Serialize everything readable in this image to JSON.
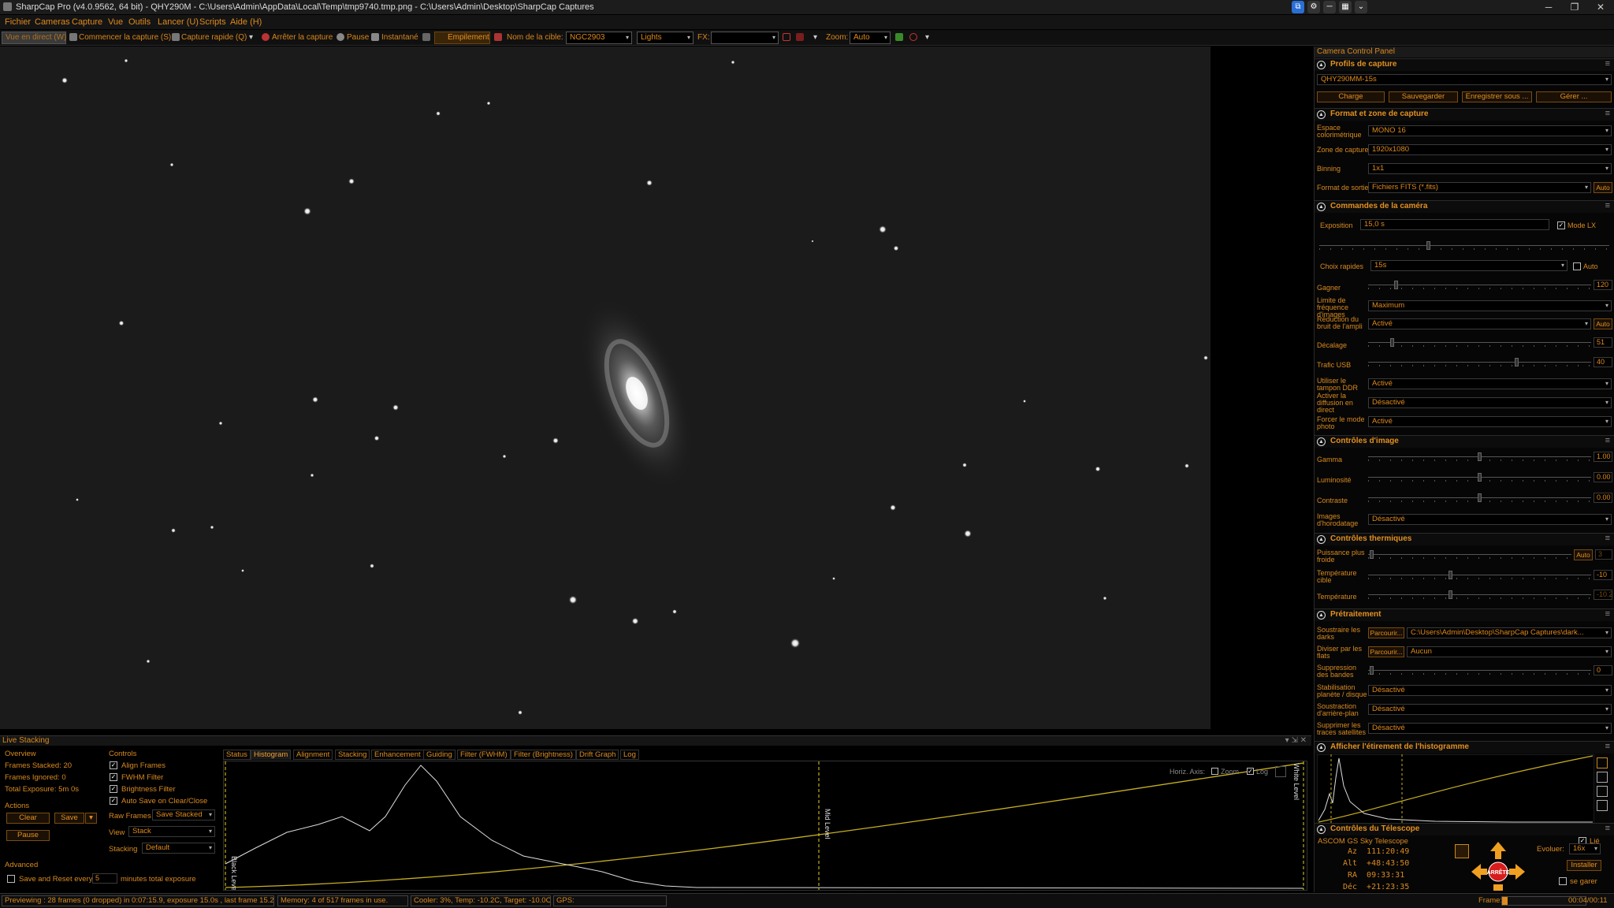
{
  "window": {
    "title": "SharpCap Pro (v4.0.9562, 64 bit) - QHY290M - C:\\Users\\Admin\\AppData\\Local\\Temp\\tmp9740.tmp.png - C:\\Users\\Admin\\Desktop\\SharpCap Captures",
    "minimize": "─",
    "maximize": "❐",
    "close": "✕"
  },
  "menu": [
    "Fichier",
    "Cameras",
    "Capture",
    "Vue",
    "Outils",
    "Lancer (U)",
    "Scripts",
    "Aide (H)"
  ],
  "toolbar": {
    "live_view": "Vue en direct (W)",
    "start_capture": "Commencer la capture (S)",
    "quick_capture": "Capture rapide (Q)",
    "stop_capture": "Arrêter la capture",
    "pause": "Pause",
    "snapshot": "Instantané",
    "stacking": "Empilement",
    "target_label": "Nom de la cible:",
    "target_value": "NGC2903",
    "frame_type": "Lights",
    "fx_label": "FX:",
    "fx_value": "",
    "zoom_label": "Zoom:",
    "zoom_value": "Auto"
  },
  "camera_panel": {
    "title": "Camera Control Panel",
    "profiles": {
      "title": "Profils de capture",
      "selected": "QHY290MM-15s",
      "buttons": [
        "Charge",
        "Sauvegarder",
        "Enregistrer sous ...",
        "Gérer ..."
      ]
    },
    "format": {
      "title": "Format et zone de capture",
      "rows": [
        {
          "label": "Espace colorimétrique",
          "value": "MONO 16"
        },
        {
          "label": "Zone de capture",
          "value": "1920x1080"
        },
        {
          "label": "Binning",
          "value": "1x1"
        },
        {
          "label": "Format de sortie",
          "value": "Fichiers FITS (*.fits)"
        }
      ],
      "auto": "Auto"
    },
    "camera_controls": {
      "title": "Commandes de la caméra",
      "exposure_label": "Exposition",
      "exposure_value": "15,0 s",
      "lx_label": "Mode LX",
      "quick_label": "Choix rapides",
      "quick_value": "15s",
      "quick_auto": "Auto",
      "gain_label": "Gagner",
      "gain_value": "120",
      "gain_level": 0.12,
      "framerate_label": "Limite de fréquence d'images",
      "framerate_value": "Maximum",
      "noise_label": "Réduction du bruit de l'ampli",
      "noise_value": "Activé",
      "noise_auto": "Auto",
      "offset_label": "Décalage",
      "offset_value": "51",
      "offset_level": 0.1,
      "usb_label": "Trafic USB",
      "usb_value": "40",
      "usb_level": 0.67,
      "ddr_label": "Utiliser le tampon DDR",
      "ddr_value": "Activé",
      "stream_label": "Activer la diffusion en direct",
      "stream_value": "Désactivé",
      "photo_label": "Forcer le mode photo",
      "photo_value": "Activé"
    },
    "image_controls": {
      "title": "Contrôles d'image",
      "gamma_label": "Gamma",
      "gamma_value": "1.00",
      "gamma_level": 0.5,
      "brightness_label": "Luminosité",
      "brightness_value": "0.00",
      "brightness_level": 0.5,
      "contrast_label": "Contraste",
      "contrast_value": "0.00",
      "contrast_level": 0.5,
      "timestamp_label": "Images d'horodatage",
      "timestamp_value": "Désactivé"
    },
    "thermal": {
      "title": "Contrôles thermiques",
      "power_label": "Puissance plus froide",
      "power_auto": "Auto",
      "power_value": "3",
      "target_label": "Température cible",
      "target_value": "-10",
      "temp_label": "Température",
      "temp_value": "-10.2"
    },
    "preprocessing": {
      "title": "Prétraitement",
      "darks_label": "Soustraire les darks",
      "browse": "Parcourir...",
      "darks_value": "C:\\Users\\Admin\\Desktop\\SharpCap Captures\\dark...",
      "flats_label": "Diviser par les flats",
      "flats_value": "Aucun",
      "banding_label": "Suppression des bandes",
      "banding_value": "0",
      "stab_label": "Stabilisation planète / disque",
      "stab_value": "Désactivé",
      "bg_label": "Soustraction d'arrière-plan",
      "bg_value": "Désactivé",
      "sat_label": "Supprimer les traces satellites",
      "sat_value": "Désactivé"
    },
    "histogram": {
      "title": "Afficher l'étirement de l'histogramme"
    },
    "telescope": {
      "title": "Contrôles du Télescope",
      "mount": "ASCOM GS Sky Telescope",
      "linked": "Lié",
      "az_label": "Az",
      "az": "111:20:49",
      "alt_label": "Alt",
      "alt": "+48:43:50",
      "ra_label": "RA",
      "ra": "09:33:31",
      "dec_label": "Déc",
      "dec": "+21:23:35",
      "speed_label": "Evoluer:",
      "speed_value": "16x",
      "install": "Installer",
      "stop": "ARRÊTE",
      "park": "se garer"
    }
  },
  "live_stacking": {
    "title": "Live Stacking",
    "overview_title": "Overview",
    "frames_stacked": "Frames Stacked: 20",
    "frames_ignored": "Frames Ignored: 0",
    "total_exposure": "Total Exposure:    5m 0s",
    "actions_title": "Actions",
    "clear": "Clear",
    "save": "Save",
    "pause": "Pause",
    "advanced_title": "Advanced",
    "save_reset": "Save and Reset every",
    "save_reset_minutes": "5",
    "minutes_total": "minutes total exposure",
    "controls_title": "Controls",
    "align": "Align Frames",
    "fwhm": "FWHM Filter",
    "brightness": "Brightness Filter",
    "autosave": "Auto Save on Clear/Close",
    "raw_frames_label": "Raw Frames",
    "raw_frames_value": "Save Stacked",
    "view_label": "View",
    "view_value": "Stack",
    "stacking_label": "Stacking",
    "stacking_value": "Default",
    "tabs": [
      "Status",
      "Histogram",
      "Alignment",
      "Stacking",
      "Enhancement",
      "Guiding",
      "Filter (FWHM)",
      "Filter (Brightness)",
      "Drift Graph",
      "Log"
    ],
    "active_tab": "Histogram",
    "hist_options": {
      "horiz": "Horiz. Axis:",
      "zoom": "Zoom",
      "log": "Log"
    },
    "black_level": "Black Level",
    "mid_level": "Mid Level",
    "white_level": "White Level"
  },
  "status": {
    "preview": "Previewing : 28 frames (0 dropped) in 0:07:15.9, exposure 15.0s , last frame 15.2s",
    "memory": "Memory: 4 of 517 frames in use.",
    "cooler": "Cooler: 3%, Temp: -10.2C, Target: -10.0C",
    "gps": "GPS:",
    "frame_label": "Frame:",
    "frame_progress": 0.07,
    "elapsed": "00:04/00:11"
  },
  "colors": {
    "accent": "#e08a1c",
    "background": "#000000"
  }
}
